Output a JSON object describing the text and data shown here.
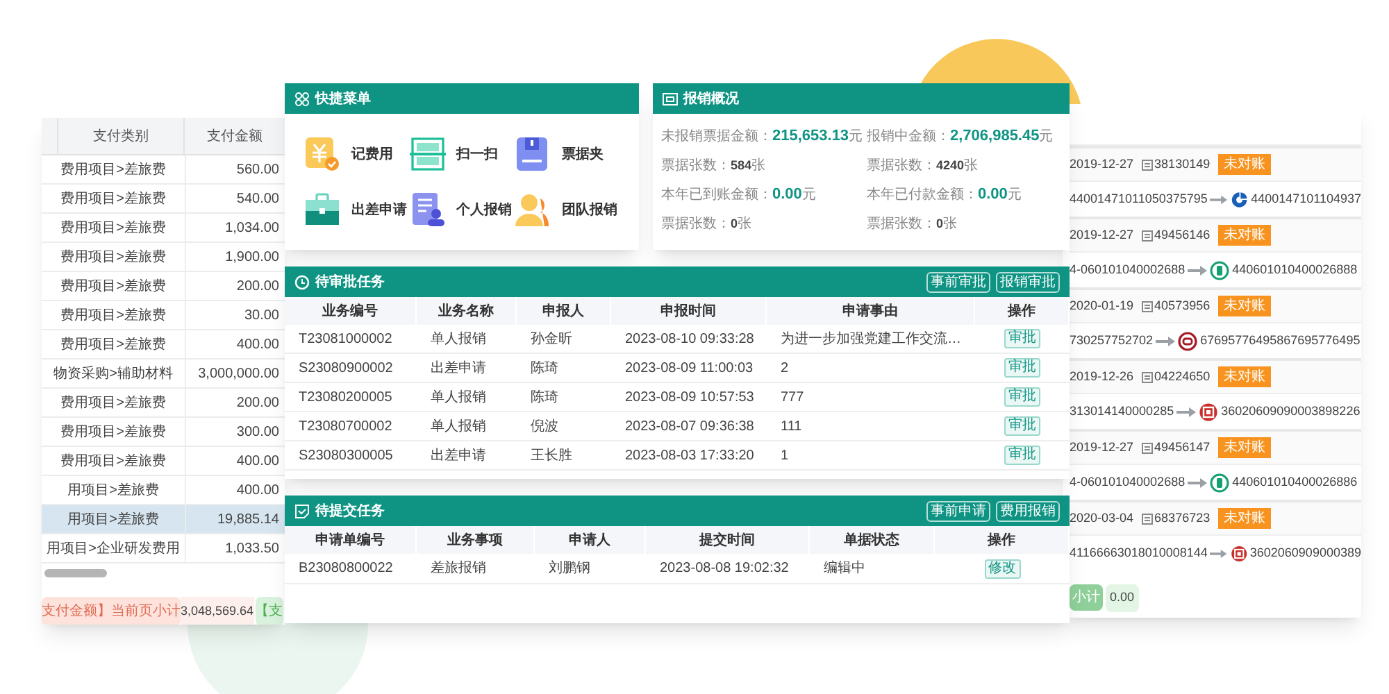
{
  "left_panel": {
    "columns": [
      "支付类别",
      "支付金额"
    ],
    "rows": [
      {
        "category": "费用项目>差旅费",
        "amount": "560.00",
        "selected": false
      },
      {
        "category": "费用项目>差旅费",
        "amount": "540.00",
        "selected": false
      },
      {
        "category": "费用项目>差旅费",
        "amount": "1,034.00",
        "selected": false
      },
      {
        "category": "费用项目>差旅费",
        "amount": "1,900.00",
        "selected": false
      },
      {
        "category": "费用项目>差旅费",
        "amount": "200.00",
        "selected": false
      },
      {
        "category": "费用项目>差旅费",
        "amount": "30.00",
        "selected": false
      },
      {
        "category": "费用项目>差旅费",
        "amount": "400.00",
        "selected": false
      },
      {
        "category": "物资采购>辅助材料",
        "amount": "3,000,000.00",
        "selected": false
      },
      {
        "category": "费用项目>差旅费",
        "amount": "200.00",
        "selected": false
      },
      {
        "category": "费用项目>差旅费",
        "amount": "300.00",
        "selected": false
      },
      {
        "category": "费用项目>差旅费",
        "amount": "400.00",
        "selected": false
      },
      {
        "category": "用项目>差旅费",
        "amount": "400.00",
        "selected": false
      },
      {
        "category": "用项目>差旅费",
        "amount": "19,885.14",
        "selected": true
      },
      {
        "category": "用项目>企业研发费用",
        "amount": "1,033.50",
        "selected": false
      }
    ],
    "footer": {
      "label": "支付金额】当前页小计",
      "total": "3,048,569.64",
      "tag": "【支"
    }
  },
  "quick_menu": {
    "title": "快捷菜单",
    "items": [
      {
        "label": "记费用",
        "kind": "yen"
      },
      {
        "label": "扫一扫",
        "kind": "scan"
      },
      {
        "label": "票据夹",
        "kind": "folder"
      },
      {
        "label": "出差申请",
        "kind": "case"
      },
      {
        "label": "个人报销",
        "kind": "person"
      },
      {
        "label": "团队报销",
        "kind": "team"
      }
    ]
  },
  "overview": {
    "title": "报销概况",
    "items": [
      {
        "label": "未报销票据金额：",
        "value": "215,653.13",
        "unit": "元",
        "kind": "amount"
      },
      {
        "label": "报销中金额：",
        "value": "2,706,985.45",
        "unit": "元",
        "kind": "amount"
      },
      {
        "label": "票据张数：",
        "value": "584",
        "unit": "张",
        "kind": "count"
      },
      {
        "label": "票据张数：",
        "value": "4240",
        "unit": "张",
        "kind": "count"
      },
      {
        "label": "本年已到账金额：",
        "value": "0.00",
        "unit": "元",
        "kind": "amount"
      },
      {
        "label": "本年已付款金额：",
        "value": "0.00",
        "unit": "元",
        "kind": "amount"
      },
      {
        "label": "票据张数：",
        "value": "0",
        "unit": "张",
        "kind": "count"
      },
      {
        "label": "票据张数：",
        "value": "0",
        "unit": "张",
        "kind": "count"
      }
    ]
  },
  "approval_tasks": {
    "title": "待审批任务",
    "buttons": [
      "事前审批",
      "报销审批"
    ],
    "columns": [
      "业务编号",
      "业务名称",
      "申报人",
      "申报时间",
      "申请事由",
      "操作"
    ],
    "rows": [
      {
        "cells": [
          "T23081000002",
          "单人报销",
          "孙金昕",
          "2023-08-10 09:33:28",
          "为进一步加强党建工作交流…"
        ],
        "action": "审批"
      },
      {
        "cells": [
          "S23080900002",
          "出差申请",
          "陈琦",
          "2023-08-09 11:00:03",
          "2"
        ],
        "action": "审批"
      },
      {
        "cells": [
          "T23080200005",
          "单人报销",
          "陈琦",
          "2023-08-09 10:57:53",
          "777"
        ],
        "action": "审批"
      },
      {
        "cells": [
          "T23080700002",
          "单人报销",
          "倪波",
          "2023-08-07 09:36:38",
          "111"
        ],
        "action": "审批"
      },
      {
        "cells": [
          "S23080300005",
          "出差申请",
          "王长胜",
          "2023-08-03 17:33:20",
          "1"
        ],
        "action": "审批"
      }
    ]
  },
  "submit_tasks": {
    "title": "待提交任务",
    "buttons": [
      "事前申请",
      "费用报销"
    ],
    "columns": [
      "申请单编号",
      "业务事项",
      "申请人",
      "提交时间",
      "单据状态",
      "操作"
    ],
    "rows": [
      {
        "cells": [
          "B23080800022",
          "差旅报销",
          "刘鹏钢",
          "2023-08-08 19:02:32",
          "编辑中"
        ],
        "action": "修改"
      }
    ]
  },
  "right_panel": {
    "records": [
      {
        "date": "2019-12-27",
        "number": "38130149",
        "status": "未对账",
        "from": "44001471011050375795",
        "kind": "ccb",
        "to": "4400147101104937"
      },
      {
        "date": "2019-12-27",
        "number": "49456146",
        "status": "未对账",
        "from": "4-060101040002688",
        "kind": "abc",
        "to": "440601010400026888"
      },
      {
        "date": "2020-01-19",
        "number": "40573956",
        "status": "未对账",
        "from": "730257752702",
        "kind": "boc",
        "to": "67695776495867695776495"
      },
      {
        "date": "2019-12-26",
        "number": "04224650",
        "status": "未对账",
        "from": "313014140000285",
        "kind": "icbc",
        "to": "36020609090003898226"
      },
      {
        "date": "2019-12-27",
        "number": "49456147",
        "status": "未对账",
        "from": "4-060101040002688",
        "kind": "abc",
        "to": "440601010400026886"
      },
      {
        "date": "2020-03-04",
        "number": "68376723",
        "status": "未对账",
        "from": "41166663018010008144",
        "kind": "icbc",
        "to": "3602060909000389"
      }
    ],
    "footer": {
      "label": "小计",
      "total": "0.00"
    }
  }
}
